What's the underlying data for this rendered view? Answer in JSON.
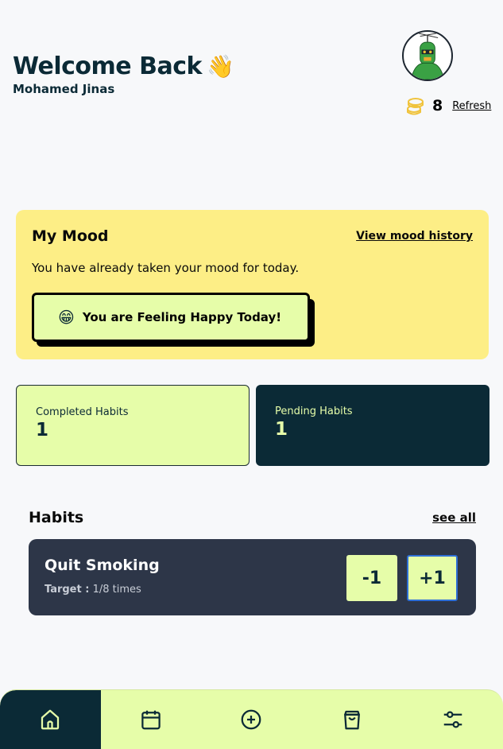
{
  "header": {
    "welcome": "Welcome Back",
    "wave_emoji": "👋",
    "username": "Mohamed Jinas"
  },
  "wallet": {
    "coins": "8",
    "refresh_label": "Refresh"
  },
  "mood": {
    "title": "My Mood",
    "history_link": "View mood history",
    "description": "You have already taken your mood for today.",
    "emoji": "😁",
    "status": "You are Feeling Happy Today!"
  },
  "stats": {
    "completed_label": "Completed Habits",
    "completed_value": "1",
    "pending_label": "Pending Habits",
    "pending_value": "1"
  },
  "habits": {
    "title": "Habits",
    "see_all": "see all",
    "items": [
      {
        "name": "Quit Smoking",
        "target_label": "Target :",
        "target_value": "1/8 times",
        "minus_label": "-1",
        "plus_label": "+1"
      }
    ]
  },
  "nav": {
    "items": [
      "home-icon",
      "calendar-icon",
      "add-circle-icon",
      "shopping-bag-icon",
      "settings-sliders-icon"
    ],
    "active": "home-icon"
  },
  "colors": {
    "primary_dark": "#0b2a36",
    "accent_lime": "#e6fda9",
    "mood_yellow": "#fdee86",
    "habit_card": "#2d3648",
    "background": "#f7f8fa"
  }
}
